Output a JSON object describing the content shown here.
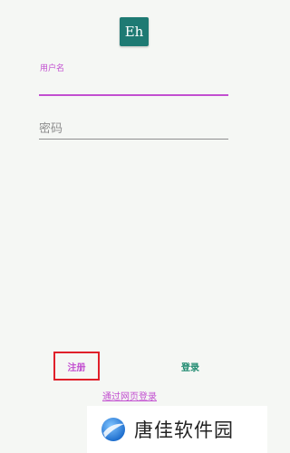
{
  "app": {
    "icon_text": "Eh",
    "accent_color": "#c24fd0",
    "brand_color": "#1e7a73"
  },
  "form": {
    "username_label": "用户名",
    "username_value": "",
    "password_placeholder": "密码"
  },
  "actions": {
    "register_label": "注册",
    "login_label": "登录",
    "web_login_label": "通过网页登录"
  },
  "watermark": {
    "text": "唐佳软件园",
    "logo_icon": "blue-orb-logo-icon"
  }
}
